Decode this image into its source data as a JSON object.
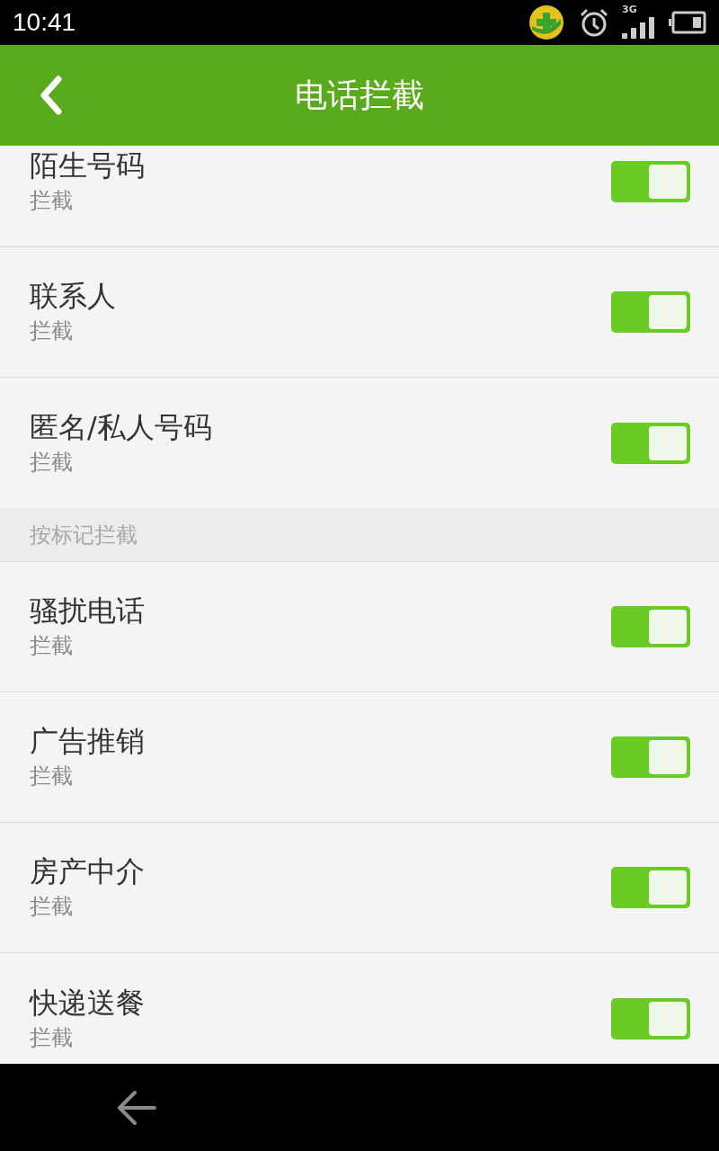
{
  "status_bar": {
    "time": "10:41",
    "network": "3G"
  },
  "header": {
    "title": "电话拦截"
  },
  "sections": [
    {
      "items": [
        {
          "title": "陌生号码",
          "subtitle": "拦截",
          "checked": true
        },
        {
          "title": "联系人",
          "subtitle": "拦截",
          "checked": true
        },
        {
          "title": "匿名/私人号码",
          "subtitle": "拦截",
          "checked": true
        }
      ]
    },
    {
      "heading": "按标记拦截",
      "items": [
        {
          "title": "骚扰电话",
          "subtitle": "拦截",
          "checked": true
        },
        {
          "title": "广告推销",
          "subtitle": "拦截",
          "checked": true
        },
        {
          "title": "房产中介",
          "subtitle": "拦截",
          "checked": true
        },
        {
          "title": "快递送餐",
          "subtitle": "拦截",
          "checked": true
        }
      ]
    }
  ]
}
